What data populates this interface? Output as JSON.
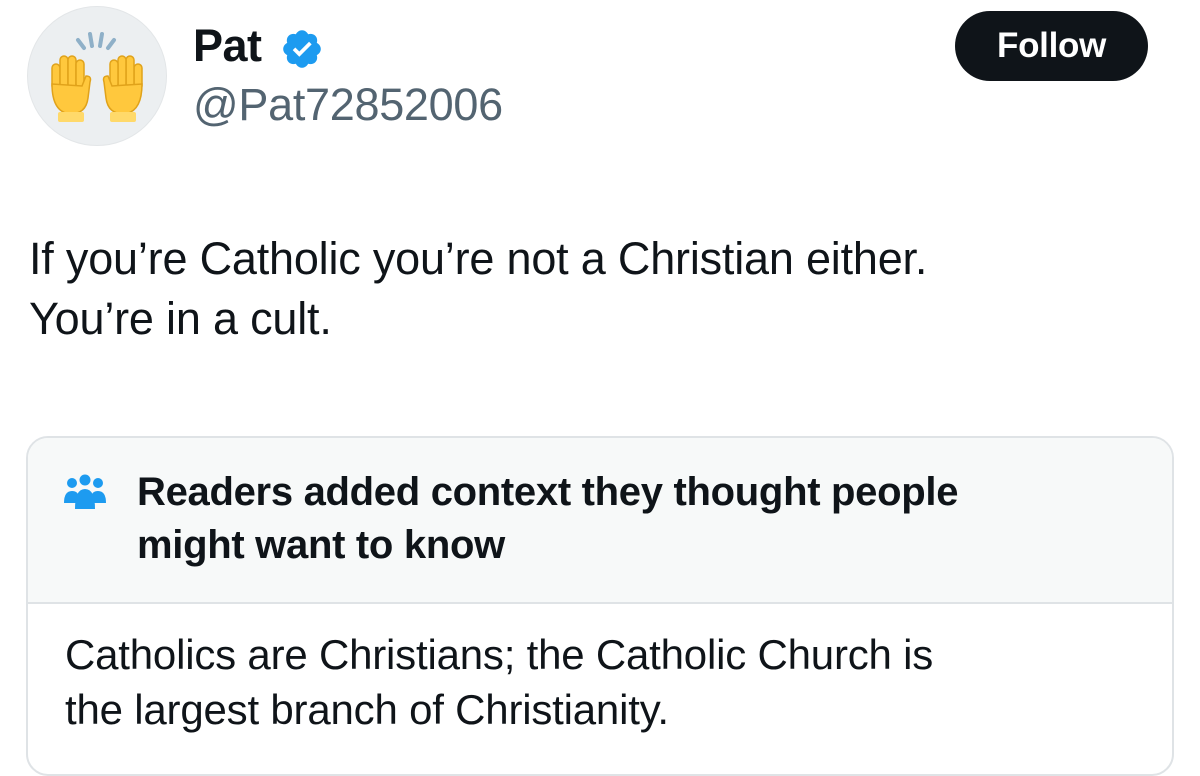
{
  "author": {
    "display_name": "Pat",
    "handle": "@Pat72852006",
    "avatar_icon": "raising-hands-emoji-icon",
    "verified_icon": "verified-badge-icon",
    "verified_color": "#1d9bf0"
  },
  "follow_button": {
    "label": "Follow"
  },
  "tweet": {
    "text_lines": [
      "If you’re Catholic you’re not a Christian either.",
      "You’re in a cult."
    ]
  },
  "community_note": {
    "icon": "people-icon",
    "icon_color": "#1d9bf0",
    "title_lines": [
      "Readers added context they thought people",
      "might want to know"
    ],
    "body_lines": [
      "Catholics are Christians; the Catholic Church is",
      "the largest branch of Christianity."
    ]
  }
}
